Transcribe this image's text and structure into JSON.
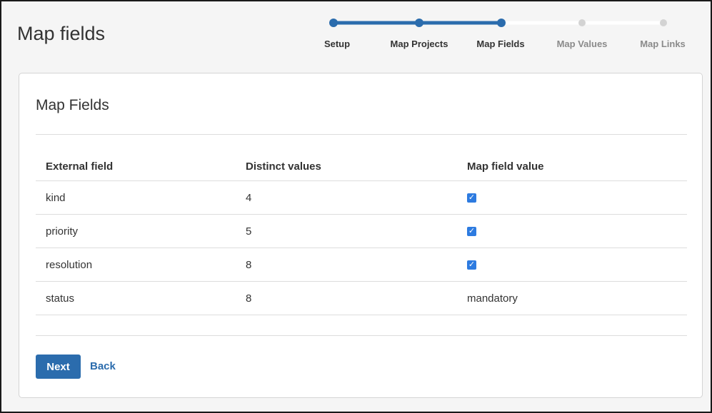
{
  "page": {
    "title": "Map fields"
  },
  "stepper": {
    "steps": [
      {
        "label": "Setup",
        "state": "done"
      },
      {
        "label": "Map Projects",
        "state": "done"
      },
      {
        "label": "Map Fields",
        "state": "current"
      },
      {
        "label": "Map Values",
        "state": "todo"
      },
      {
        "label": "Map Links",
        "state": "todo"
      }
    ],
    "colors": {
      "done": "#2b6cad",
      "todo": "#d3d3d3"
    }
  },
  "card": {
    "title": "Map Fields",
    "table": {
      "headers": [
        "External field",
        "Distinct values",
        "Map field value"
      ],
      "rows": [
        {
          "field": "kind",
          "distinct": "4",
          "map": "checked"
        },
        {
          "field": "priority",
          "distinct": "5",
          "map": "checked"
        },
        {
          "field": "resolution",
          "distinct": "8",
          "map": "checked"
        },
        {
          "field": "status",
          "distinct": "8",
          "map": "mandatory"
        }
      ]
    },
    "buttons": {
      "next": "Next",
      "back": "Back"
    }
  }
}
